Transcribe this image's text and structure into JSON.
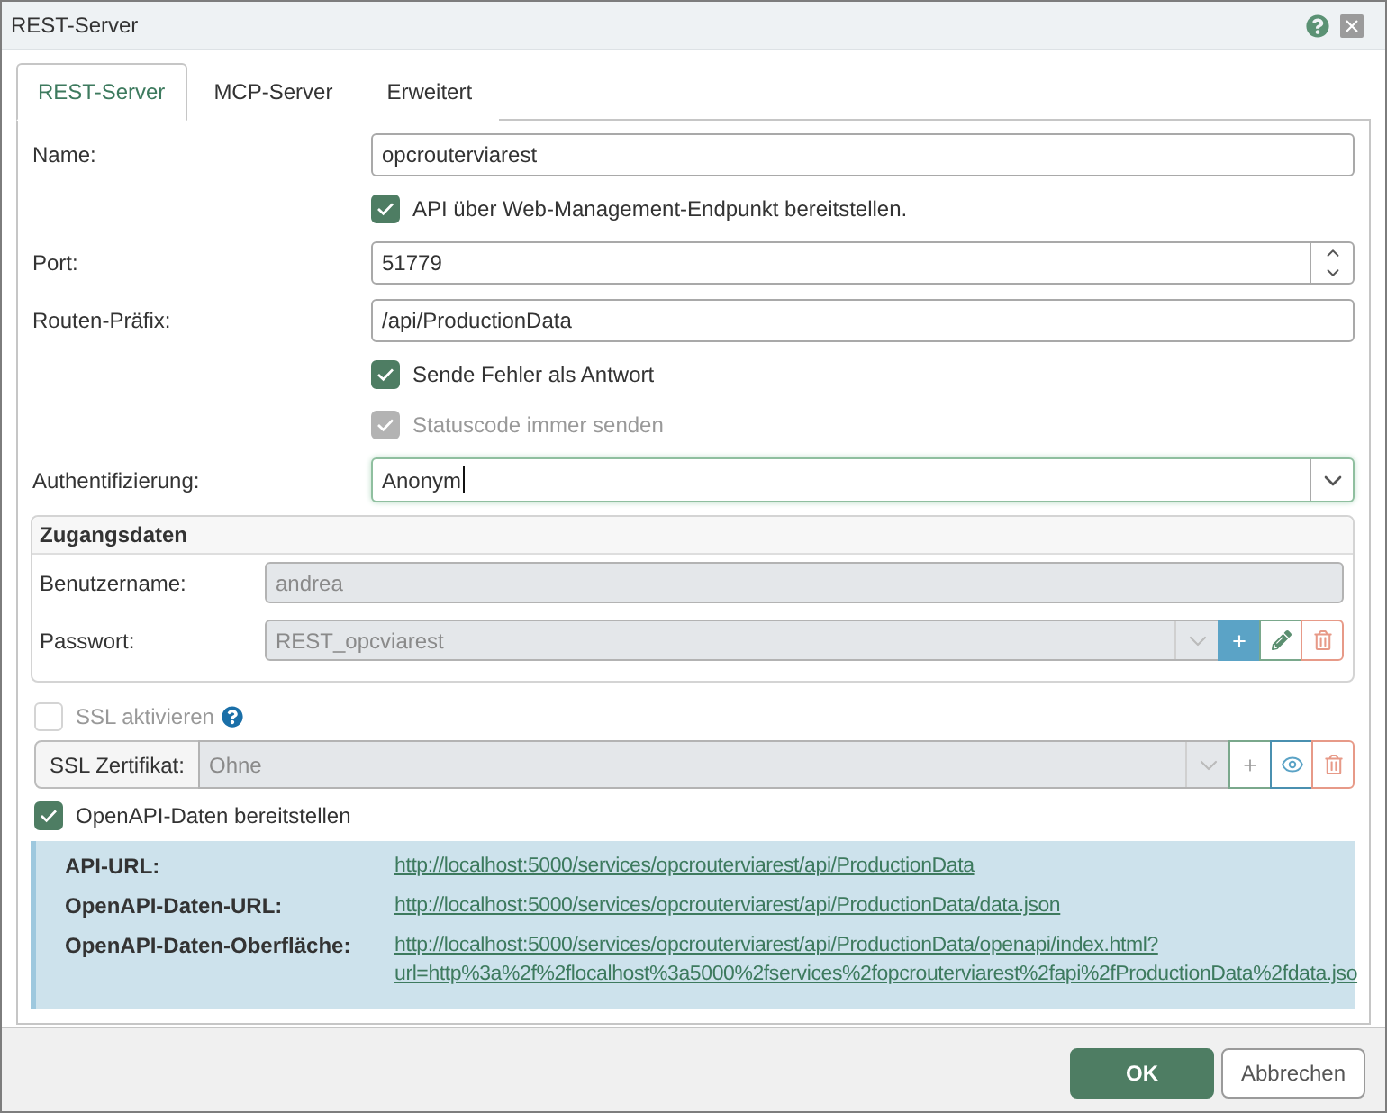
{
  "window": {
    "title": "REST-Server"
  },
  "tabs": [
    {
      "label": "REST-Server",
      "selected": true
    },
    {
      "label": "MCP-Server",
      "selected": false
    },
    {
      "label": "Erweitert",
      "selected": false
    }
  ],
  "form": {
    "rows": [
      {
        "kind": "text",
        "label": "Name:",
        "value": "opcrouterviarest"
      },
      {
        "kind": "checkbox",
        "label": "API über Web-Management-Endpunkt bereitstellen.",
        "checked": true,
        "disabled": false
      },
      {
        "kind": "number",
        "label": "Port:",
        "value": "51779"
      },
      {
        "kind": "text",
        "label": "Routen-Präfix:",
        "value": "/api/ProductionData"
      },
      {
        "kind": "checkbox",
        "label": "Sende Fehler als Antwort",
        "checked": true,
        "disabled": false
      },
      {
        "kind": "checkbox",
        "label": "Statuscode immer senden",
        "checked": true,
        "disabled": true
      },
      {
        "kind": "select",
        "label": "Authentifizierung:",
        "value": "Anonym",
        "focused": true
      }
    ]
  },
  "credentials": {
    "title": "Zugangsdaten",
    "username": {
      "label": "Benutzername:",
      "value": "andrea",
      "disabled": true
    },
    "password": {
      "label": "Passwort:",
      "value": "REST_opcviarest",
      "disabled": true
    }
  },
  "ssl": {
    "enable": {
      "label": "SSL aktivieren",
      "checked": false,
      "disabled": true
    },
    "certificate": {
      "label": "SSL Zertifikat:",
      "value": "Ohne",
      "disabled": true
    }
  },
  "openapi": {
    "label": "OpenAPI-Daten bereitstellen",
    "checked": true,
    "links": [
      {
        "label": "API-URL:",
        "url": "http://localhost:5000/services/opcrouterviarest/api/ProductionData"
      },
      {
        "label": "OpenAPI-Daten-URL:",
        "url": "http://localhost:5000/services/opcrouterviarest/api/ProductionData/data.json"
      },
      {
        "label": "OpenAPI-Daten-Oberfläche:",
        "url": "http://localhost:5000/services/opcrouterviarest/api/ProductionData/openapi/index.html?\nurl=http%3a%2f%2flocalhost%3a5000%2fservices%2fopcrouterviarest%2fapi%2fProductionData%2fdata.jso"
      }
    ]
  },
  "buttons": [
    {
      "label": "OK",
      "kind": "primary"
    },
    {
      "label": "Abbrechen",
      "kind": "secondary"
    }
  ]
}
